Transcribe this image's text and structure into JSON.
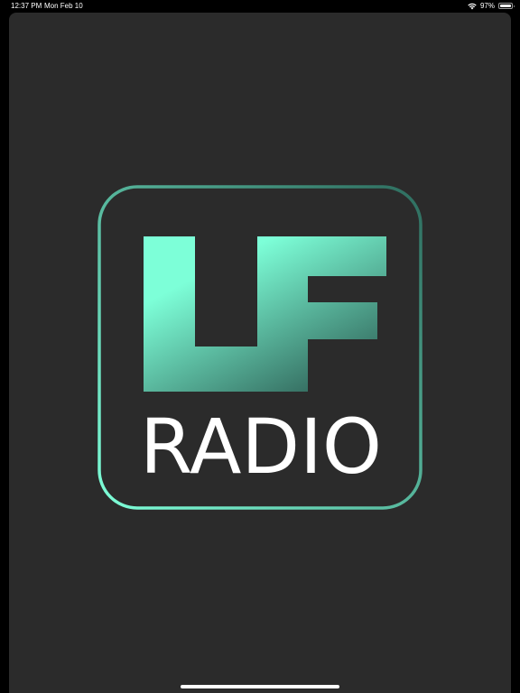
{
  "status_bar": {
    "time": "12:37 PM",
    "date": "Mon Feb 10",
    "battery_text": "97%",
    "battery_level": 0.97,
    "wifi_icon": "wifi-icon"
  },
  "logo": {
    "letters": "LF",
    "word": "RADIO",
    "colors": {
      "frame_start": "#7effd9",
      "frame_end": "#2e6d5f",
      "mark_start": "#7dffd8",
      "mark_end": "#31655a",
      "word": "#ffffff"
    }
  },
  "colors": {
    "background": "#2b2b2b",
    "status_background": "#000000"
  }
}
